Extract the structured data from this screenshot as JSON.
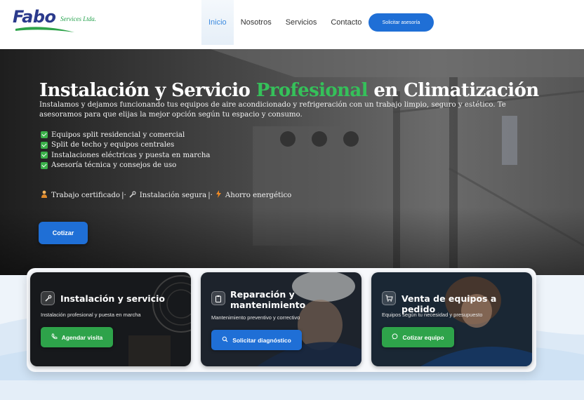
{
  "header": {
    "logo_main": "Fabo",
    "logo_sub": "Services Ltda.",
    "nav": [
      {
        "label": "Inicio",
        "active": true
      },
      {
        "label": "Nosotros",
        "active": false
      },
      {
        "label": "Servicios",
        "active": false
      },
      {
        "label": "Contacto",
        "active": false
      }
    ],
    "cta_label": "Solicitar asesoría"
  },
  "hero": {
    "title_part1": "Instalación y Servicio ",
    "title_highlight": "Profesional",
    "title_part2": " en Climatización",
    "description": "Instalamos y dejamos funcionando tus equipos de aire acondicionado y refrigeración con un trabajo limpio, seguro y estético. Te asesoramos para que elijas la mejor opción según tu espacio y consumo.",
    "checklist": [
      "Equipos split residencial y comercial",
      "Split de techo y equipos centrales",
      "Instalaciones eléctricas y puesta en marcha",
      "Asesoría técnica y consejos de uso"
    ],
    "badges": [
      {
        "icon": "worker-icon",
        "label": "Trabajo certificado"
      },
      {
        "icon": "wrench-icon",
        "label": "Instalación segura"
      },
      {
        "icon": "lightning-icon",
        "label": "Ahorro energético"
      }
    ],
    "badge_separator": "|·",
    "cta_label": "Cotizar"
  },
  "cards": [
    {
      "icon": "tools-icon",
      "title": "Instalación y servicio",
      "subtitle": "Instalación profesional y puesta en marcha",
      "button": "Agendar visita",
      "button_icon": "phone-icon",
      "button_color": "#2ea34a"
    },
    {
      "icon": "clipboard-icon",
      "title": "Reparación y mantenimiento",
      "subtitle": "Mantenimiento preventivo y correctivo",
      "button": "Solicitar diagnóstico",
      "button_icon": "search-icon",
      "button_color": "#1f6fd6"
    },
    {
      "icon": "cart-icon",
      "title": "Venta de equipos a pedido",
      "subtitle": "Equipos según tu necesidad y presupuesto",
      "button": "Cotizar equipo",
      "button_icon": "chat-icon",
      "button_color": "#2ea34a"
    }
  ],
  "colors": {
    "brand_blue": "#1f6fd6",
    "brand_green": "#2ea34a",
    "highlight_green": "#35c15a",
    "logo_navy": "#2b3a8c"
  }
}
